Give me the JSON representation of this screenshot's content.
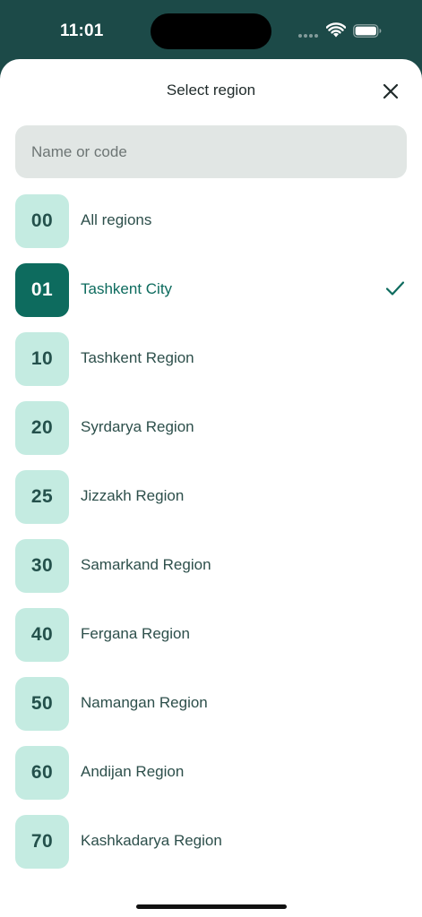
{
  "status_bar": {
    "time": "11:01"
  },
  "sheet": {
    "title": "Select region",
    "close_icon": "close-icon"
  },
  "search": {
    "placeholder": "Name or code",
    "value": ""
  },
  "colors": {
    "header_bg": "#1c4a48",
    "badge_bg": "#c4ebe1",
    "badge_text": "#24514c",
    "selected_bg": "#0d6b5e",
    "selected_text": "#ffffff"
  },
  "regions": [
    {
      "code": "00",
      "name": "All regions",
      "selected": false
    },
    {
      "code": "01",
      "name": "Tashkent City",
      "selected": true
    },
    {
      "code": "10",
      "name": "Tashkent Region",
      "selected": false
    },
    {
      "code": "20",
      "name": "Syrdarya Region",
      "selected": false
    },
    {
      "code": "25",
      "name": "Jizzakh Region",
      "selected": false
    },
    {
      "code": "30",
      "name": "Samarkand Region",
      "selected": false
    },
    {
      "code": "40",
      "name": "Fergana Region",
      "selected": false
    },
    {
      "code": "50",
      "name": "Namangan Region",
      "selected": false
    },
    {
      "code": "60",
      "name": "Andijan Region",
      "selected": false
    },
    {
      "code": "70",
      "name": "Kashkadarya Region",
      "selected": false
    }
  ]
}
